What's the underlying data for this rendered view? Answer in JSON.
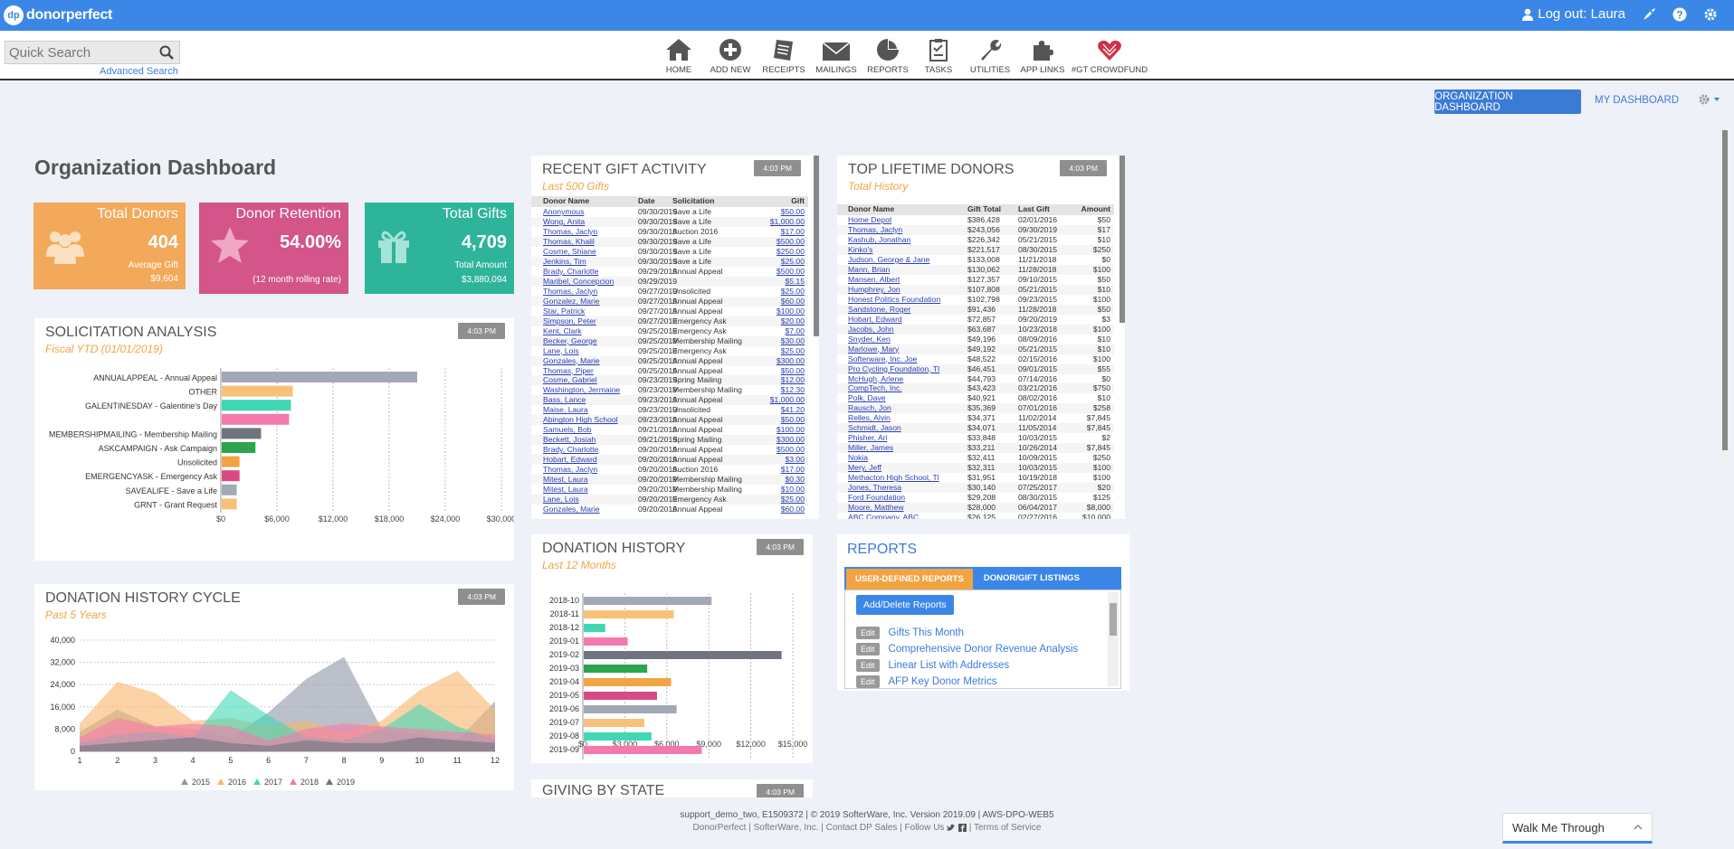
{
  "brand": {
    "name": "donorperfect",
    "badge": "dp"
  },
  "topbar": {
    "logout": "Log out: Laura"
  },
  "search": {
    "placeholder": "Quick Search",
    "advanced": "Advanced Search"
  },
  "nav": [
    {
      "label": "HOME",
      "icon": "home-icon"
    },
    {
      "label": "ADD NEW",
      "icon": "add-new-icon"
    },
    {
      "label": "RECEIPTS",
      "icon": "receipts-icon"
    },
    {
      "label": "MAILINGS",
      "icon": "mailings-icon"
    },
    {
      "label": "REPORTS",
      "icon": "reports-icon"
    },
    {
      "label": "TASKS",
      "icon": "tasks-icon"
    },
    {
      "label": "UTILITIES",
      "icon": "utilities-icon"
    },
    {
      "label": "APP LINKS",
      "icon": "app-links-icon"
    },
    {
      "label": "#GT CROWDFUND",
      "icon": "crowdfund-icon"
    }
  ],
  "dashboard_tabs": {
    "org": "ORGANIZATION DASHBOARD",
    "my": "MY DASHBOARD"
  },
  "page_title": "Organization Dashboard",
  "stats": {
    "donors": {
      "title": "Total Donors",
      "value": "404",
      "sub1": "Average Gift",
      "sub2": "$9,604",
      "color": "#f3a95a"
    },
    "retention": {
      "title": "Donor Retention",
      "value": "54.00%",
      "sub1": "(12 month rolling rate)",
      "color": "#d35589"
    },
    "gifts": {
      "title": "Total Gifts",
      "value": "4,709",
      "sub1": "Total Amount",
      "sub2": "$3,880,094",
      "color": "#2fb49c"
    }
  },
  "timestamp": "4:03 PM",
  "solicitation": {
    "title": "SOLICITATION ANALYSIS",
    "subtitle": "Fiscal YTD (01/01/2019)"
  },
  "cycle": {
    "title": "DONATION HISTORY CYCLE",
    "subtitle": "Past 5 Years"
  },
  "recent": {
    "title": "RECENT GIFT ACTIVITY",
    "subtitle": "Last 500 Gifts",
    "headers": [
      "Donor Name",
      "Date",
      "Solicitation",
      "Gift"
    ],
    "rows": [
      [
        "Anonymous",
        "09/30/2019",
        "Save a Life",
        "$50.00"
      ],
      [
        "Wong, Anita",
        "09/30/2019",
        "Save a Life",
        "$1,000.00"
      ],
      [
        "Thomas, Jaclyn",
        "09/30/2019",
        "Auction 2016",
        "$17.00"
      ],
      [
        "Thomas, Khalil",
        "09/30/2019",
        "Save a Life",
        "$500.00"
      ],
      [
        "Cosme, Shiane",
        "09/30/2019",
        "Save a Life",
        "$250.00"
      ],
      [
        "Jenkins, Tim",
        "09/30/2019",
        "Save a Life",
        "$25.00"
      ],
      [
        "Brady, Charlotte",
        "09/29/2019",
        "Annual Appeal",
        "$500.00"
      ],
      [
        "Maribel, Concepcion",
        "09/29/2019",
        "",
        "$5.15"
      ],
      [
        "Thomas, Jaclyn",
        "09/27/2019",
        "Unsolicited",
        "$25.00"
      ],
      [
        "Gonzalez, Marie",
        "09/27/2019",
        "Annual Appeal",
        "$60.00"
      ],
      [
        "Star, Patrick",
        "09/27/2019",
        "Annual Appeal",
        "$100.00"
      ],
      [
        "Simpson, Peter",
        "09/27/2019",
        "Emergency Ask",
        "$20.00"
      ],
      [
        "Kent, Clark",
        "09/25/2019",
        "Emergency Ask",
        "$7.00"
      ],
      [
        "Becker, George",
        "09/25/2019",
        "Membership Mailing",
        "$30.00"
      ],
      [
        "Lane, Lois",
        "09/25/2019",
        "Emergency Ask",
        "$25.00"
      ],
      [
        "Gonzales, Marie",
        "09/25/2019",
        "Annual Appeal",
        "$300.00"
      ],
      [
        "Thomas, Piper",
        "09/25/2019",
        "Annual Appeal",
        "$50.00"
      ],
      [
        "Cosme, Gabriel",
        "09/23/2019",
        "Spring Mailing",
        "$12.00"
      ],
      [
        "Washington, Jermaine",
        "09/23/2019",
        "Membership Mailing",
        "$12.30"
      ],
      [
        "Bass, Lance",
        "09/23/2019",
        "Annual Appeal",
        "$1,000.00"
      ],
      [
        "Maise, Laura",
        "09/23/2019",
        "Unsolicited",
        "$41.20"
      ],
      [
        "Abington High School",
        "09/23/2019",
        "Annual Appeal",
        "$50.00"
      ],
      [
        "Samuels, Bob",
        "09/21/2019",
        "Annual Appeal",
        "$100.00"
      ],
      [
        "Beckett, Josiah",
        "09/21/2019",
        "Spring Mailing",
        "$300.00"
      ],
      [
        "Brady, Charlotte",
        "09/20/2019",
        "Annual Appeal",
        "$500.00"
      ],
      [
        "Hobart, Edward",
        "09/20/2019",
        "Annual Appeal",
        "$3.00"
      ],
      [
        "Thomas, Jaclyn",
        "09/20/2019",
        "Auction 2016",
        "$17.00"
      ],
      [
        "Mitest, Laura",
        "09/20/2019",
        "Membership Mailing",
        "$0.30"
      ],
      [
        "Mitest, Laura",
        "09/20/2019",
        "Membership Mailing",
        "$10.00"
      ],
      [
        "Lane, Lois",
        "09/20/2019",
        "Emergency Ask",
        "$25.00"
      ],
      [
        "Gonzales, Marie",
        "09/20/2019",
        "Annual Appeal",
        "$60.00"
      ]
    ]
  },
  "donors_top": {
    "title": "TOP LIFETIME DONORS",
    "subtitle": "Total History",
    "headers": [
      "Donor Name",
      "Gift Total",
      "Last Gift",
      "Amount"
    ],
    "rows": [
      [
        "Home Depot",
        "$386,428",
        "02/01/2016",
        "$50"
      ],
      [
        "Thomas, Jaclyn",
        "$243,056",
        "09/30/2019",
        "$17"
      ],
      [
        "Kashub, Jonathan",
        "$226,342",
        "05/21/2015",
        "$10"
      ],
      [
        "Kinko's",
        "$221,517",
        "08/30/2015",
        "$250"
      ],
      [
        "Judson, George & Jane",
        "$133,008",
        "11/21/2018",
        "$0"
      ],
      [
        "Mann, Brian",
        "$130,062",
        "11/28/2018",
        "$100"
      ],
      [
        "Mansen, Albert",
        "$127,357",
        "09/10/2015",
        "$50"
      ],
      [
        "Humphrey, Jon",
        "$107,808",
        "05/21/2015",
        "$10"
      ],
      [
        "Honest Politics Foundation",
        "$102,798",
        "09/23/2015",
        "$100"
      ],
      [
        "Sandstone, Roger",
        "$91,436",
        "11/28/2018",
        "$50"
      ],
      [
        "Hobart, Edward",
        "$72,857",
        "09/20/2019",
        "$3"
      ],
      [
        "Jacobs, John",
        "$63,687",
        "10/23/2018",
        "$100"
      ],
      [
        "Snyder, Ken",
        "$49,196",
        "08/09/2016",
        "$10"
      ],
      [
        "Marlowe, Mary",
        "$49,192",
        "05/21/2015",
        "$10"
      ],
      [
        "Softerware, Inc. Joe",
        "$48,522",
        "02/15/2016",
        "$100"
      ],
      [
        "Pro Cycling Foundation, Tl",
        "$46,451",
        "09/01/2015",
        "$55"
      ],
      [
        "McHugh, Arlene",
        "$44,793",
        "07/14/2016",
        "$0"
      ],
      [
        "CompTech, Inc.",
        "$43,423",
        "03/21/2016",
        "$750"
      ],
      [
        "Polk, Dave",
        "$40,921",
        "08/02/2016",
        "$10"
      ],
      [
        "Rausch, Jon",
        "$35,369",
        "07/01/2016",
        "$258"
      ],
      [
        "Relles, Alvin",
        "$34,371",
        "11/02/2014",
        "$7,845"
      ],
      [
        "Schmidt, Jason",
        "$34,071",
        "11/05/2014",
        "$7,845"
      ],
      [
        "Phisher, Ari",
        "$33,848",
        "10/03/2015",
        "$2"
      ],
      [
        "Miller, James",
        "$33,211",
        "10/26/2014",
        "$7,845"
      ],
      [
        "Nokia",
        "$32,411",
        "10/09/2015",
        "$250"
      ],
      [
        "Mery, Jeff",
        "$32,311",
        "10/03/2015",
        "$100"
      ],
      [
        "Methacton High School, Tl",
        "$31,951",
        "10/19/2018",
        "$100"
      ],
      [
        "Jones, Theresa",
        "$30,140",
        "07/25/2017",
        "$20"
      ],
      [
        "Ford Foundation",
        "$29,208",
        "08/30/2015",
        "$125"
      ],
      [
        "Moore, Matthew",
        "$28,000",
        "06/04/2017",
        "$8,000"
      ],
      [
        "ABC Company, ABC",
        "$26,125",
        "02/27/2016",
        "$10,000"
      ]
    ]
  },
  "history": {
    "title": "DONATION HISTORY",
    "subtitle": "Last 12 Months"
  },
  "reports": {
    "title": "REPORTS",
    "tab1": "USER-DEFINED REPORTS",
    "tab2": "DONOR/GIFT LISTINGS",
    "add_delete": "Add/Delete Reports",
    "edit_label": "Edit",
    "items": [
      "Gifts This Month",
      "Comprehensive Donor Revenue Analysis",
      "Linear List with Addresses",
      "AFP Key Donor Metrics"
    ]
  },
  "giving_state": {
    "title": "GIVING BY STATE"
  },
  "footer": {
    "line1": "support_demo_two, E1509372 | © 2019 SofterWare, Inc. Version 2019.09 | AWS-DPO-WEB5",
    "line2a": "DonorPerfect | SofterWare, Inc. | Contact DP Sales | Follow Us",
    "line2b": "| Terms of Service"
  },
  "walk_me": "Walk Me Through",
  "chart_data": [
    {
      "type": "bar",
      "orientation": "horizontal",
      "title": "SOLICITATION ANALYSIS",
      "categories": [
        "ANNUALAPPEAL - Annual Appeal",
        "OTHER",
        "GALENTINESDAY - Galentine's Day",
        "",
        "MEMBERSHIPMAILING - Membership Mailing",
        "ASKCAMPAIGN - Ask Campaign",
        "Unsolicited",
        "EMERGENCYASK - Emergency Ask",
        "SAVEALIFE - Save a Life",
        "GRNT - Grant Request"
      ],
      "values": [
        21000,
        7700,
        7500,
        7300,
        4300,
        3700,
        2000,
        2000,
        1700,
        1700
      ],
      "colors": [
        "#a3a8b6",
        "#f9c07a",
        "#3fd7b5",
        "#f57aab",
        "#6f7480",
        "#2ca34c",
        "#f2a443",
        "#d94a84",
        "#a3a8b6",
        "#f9c07a"
      ],
      "xlim": [
        0,
        30000
      ],
      "xticks": [
        "$0",
        "$6,000",
        "$12,000",
        "$18,000",
        "$24,000",
        "$30,000"
      ],
      "grid": true
    },
    {
      "type": "area",
      "title": "DONATION HISTORY CYCLE",
      "x": [
        1,
        2,
        3,
        4,
        5,
        6,
        7,
        8,
        9,
        10,
        11,
        12
      ],
      "ylim": [
        0,
        40000
      ],
      "yticks": [
        "0",
        "8,000",
        "16,000",
        "24,000",
        "32,000",
        "40,000"
      ],
      "series": [
        {
          "name": "2015",
          "color": "#8e96a8",
          "values": [
            7000,
            15000,
            9000,
            8000,
            5000,
            14000,
            26000,
            34000,
            8000,
            6000,
            4000,
            18000
          ]
        },
        {
          "name": "2016",
          "color": "#f9b56a",
          "values": [
            10000,
            25000,
            21000,
            11000,
            12000,
            9000,
            11000,
            7000,
            11000,
            22000,
            29000,
            15000
          ]
        },
        {
          "name": "2017",
          "color": "#3fd7b5",
          "values": [
            3000,
            6000,
            7000,
            5000,
            22000,
            13000,
            5000,
            4000,
            8000,
            17000,
            9000,
            4000
          ]
        },
        {
          "name": "2018",
          "color": "#f57aab",
          "values": [
            5000,
            12000,
            9000,
            10000,
            9000,
            4000,
            8000,
            10000,
            9000,
            8000,
            7000,
            6000
          ]
        },
        {
          "name": "2019",
          "color": "#6f7480",
          "values": [
            2000,
            3000,
            4000,
            5000,
            3000,
            2000,
            4000,
            3000,
            3000,
            5000,
            4000,
            3000
          ]
        }
      ],
      "legend": "bottom"
    },
    {
      "type": "bar",
      "orientation": "horizontal",
      "title": "DONATION HISTORY",
      "categories": [
        "2018-10",
        "2018-11",
        "2018-12",
        "2019-01",
        "2019-02",
        "2019-03",
        "2019-04",
        "2019-05",
        "2019-06",
        "2019-07",
        "2019-08",
        "2019-09"
      ],
      "values": [
        9200,
        6500,
        1600,
        3200,
        14200,
        4600,
        6300,
        5300,
        6700,
        4400,
        4900,
        8500
      ],
      "colors": [
        "#a3a8b6",
        "#f9c07a",
        "#3fd7b5",
        "#f57aab",
        "#6f7480",
        "#2ca34c",
        "#f2a443",
        "#d94a84",
        "#a3a8b6",
        "#f9c07a",
        "#3fd7b5",
        "#f57aab"
      ],
      "xlim": [
        0,
        15000
      ],
      "xticks": [
        "$0",
        "$3,000",
        "$6,000",
        "$9,000",
        "$12,000",
        "$15,000"
      ],
      "grid": true
    }
  ]
}
